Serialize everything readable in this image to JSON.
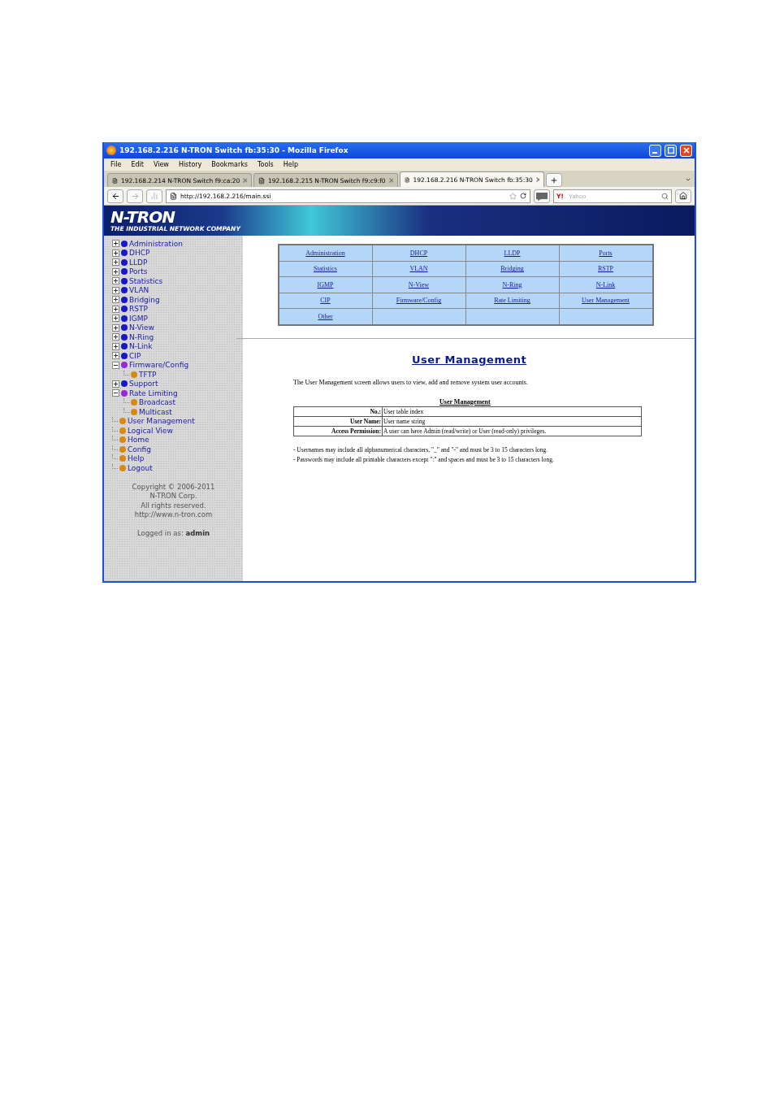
{
  "window": {
    "title": "192.168.2.216 N-TRON Switch fb:35:30 - Mozilla Firefox"
  },
  "menu": [
    "File",
    "Edit",
    "View",
    "History",
    "Bookmarks",
    "Tools",
    "Help"
  ],
  "tabs": [
    {
      "label": "192.168.2.214 N-TRON Switch f9:ca:20",
      "selected": false
    },
    {
      "label": "192.168.2.215 N-TRON Switch f9:c9:f0",
      "selected": false
    },
    {
      "label": "192.168.2.216 N-TRON Switch fb:35:30",
      "selected": true
    }
  ],
  "address": {
    "value": "http://192.168.2.216/main.ssi"
  },
  "search": {
    "engine": "Y!",
    "placeholder": "Yahoo"
  },
  "banner": {
    "logo": "N-TRON",
    "tagline": "THE INDUSTRIAL NETWORK COMPANY"
  },
  "sidebar": {
    "items": [
      {
        "label": "Administration",
        "kind": "folder",
        "expanded": false
      },
      {
        "label": "DHCP",
        "kind": "folder",
        "expanded": false
      },
      {
        "label": "LLDP",
        "kind": "folder",
        "expanded": false
      },
      {
        "label": "Ports",
        "kind": "folder",
        "expanded": false
      },
      {
        "label": "Statistics",
        "kind": "folder",
        "expanded": false
      },
      {
        "label": "VLAN",
        "kind": "folder",
        "expanded": false
      },
      {
        "label": "Bridging",
        "kind": "folder",
        "expanded": false
      },
      {
        "label": "RSTP",
        "kind": "folder",
        "expanded": false
      },
      {
        "label": "IGMP",
        "kind": "folder",
        "expanded": false
      },
      {
        "label": "N-View",
        "kind": "folder",
        "expanded": false
      },
      {
        "label": "N-Ring",
        "kind": "folder",
        "expanded": false
      },
      {
        "label": "N-Link",
        "kind": "folder",
        "expanded": false
      },
      {
        "label": "CIP",
        "kind": "folder",
        "expanded": false
      },
      {
        "label": "Firmware/Config",
        "kind": "folder",
        "expanded": true,
        "children": [
          {
            "label": "TFTP",
            "kind": "page"
          }
        ]
      },
      {
        "label": "Support",
        "kind": "folder",
        "expanded": false
      },
      {
        "label": "Rate Limiting",
        "kind": "folder",
        "expanded": true,
        "children": [
          {
            "label": "Broadcast",
            "kind": "page"
          },
          {
            "label": "Multicast",
            "kind": "page"
          }
        ]
      },
      {
        "label": "User Management",
        "kind": "page"
      },
      {
        "label": "Logical View",
        "kind": "page"
      },
      {
        "label": "Home",
        "kind": "page"
      },
      {
        "label": "Config",
        "kind": "page"
      },
      {
        "label": "Help",
        "kind": "page"
      },
      {
        "label": "Logout",
        "kind": "page"
      }
    ],
    "footer": [
      "Copyright © 2006-2011",
      "N-TRON Corp.",
      "All rights reserved.",
      "http://www.n-tron.com"
    ],
    "login": "Logged in as: **admin**"
  },
  "nav_links": [
    "Administration",
    "DHCP",
    "LLDP",
    "Ports",
    "Statistics",
    "VLAN",
    "Bridging",
    "RSTP",
    "IGMP",
    "N-View",
    "N-Ring",
    "N-Link",
    "CIP",
    "Firmware/Config",
    "Rate Limiting",
    "User Management",
    "Other"
  ],
  "help": {
    "title": "User Management",
    "intro": "The User Management screen allows users to view, add and remove system user accounts.",
    "table_title": "User Management",
    "rows": [
      {
        "label": "No.:",
        "text": "User table index"
      },
      {
        "label": "User Name:",
        "text": "User name string"
      },
      {
        "label": "Access Permission:",
        "text": "A user can have Admin (read/write) or User (read-only) privileges."
      }
    ],
    "notes": [
      "- Usernames may include all alphanumerical characters, \"_\" and \"-\" and must be 3 to 15 characters long.",
      "- Passwords may include all printable characters except \":\" and spaces and must be 3 to 15 characters long."
    ]
  }
}
